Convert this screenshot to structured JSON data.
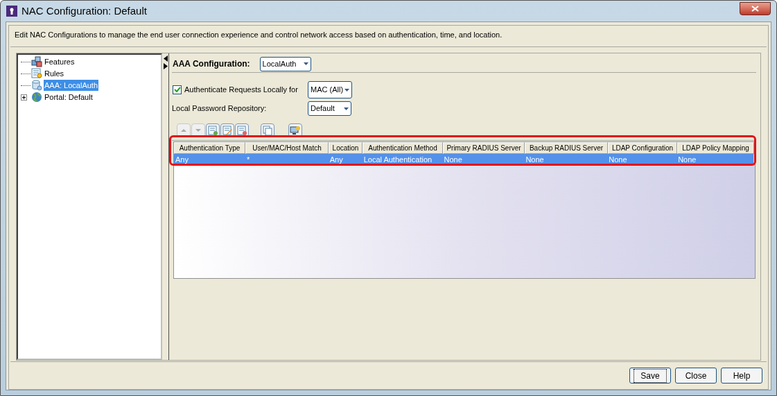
{
  "window": {
    "title": "NAC Configuration: Default"
  },
  "description": "Edit NAC Configurations to manage the end user connection experience and control network access based on authentication, time, and location.",
  "tree": [
    {
      "label": "Features",
      "kind": "features",
      "selected": false
    },
    {
      "label": "Rules",
      "kind": "rules",
      "selected": false
    },
    {
      "label": "AAA: LocalAuth",
      "kind": "database",
      "selected": true
    },
    {
      "label": "Portal: Default",
      "kind": "globe",
      "selected": false,
      "expanded": false
    }
  ],
  "aaa": {
    "label": "AAA Configuration:",
    "value": "LocalAuth"
  },
  "local_auth": {
    "label": "Authenticate Requests Locally for",
    "checked": true,
    "value": "MAC (All)"
  },
  "repository": {
    "label": "Local Password Repository:",
    "value": "Default"
  },
  "toolbar": [
    {
      "kind": "up",
      "disabled": true
    },
    {
      "kind": "down",
      "disabled": true
    },
    {
      "kind": "add",
      "disabled": false
    },
    {
      "kind": "edit",
      "disabled": false
    },
    {
      "kind": "remove",
      "disabled": false
    },
    {
      "kind": "copy",
      "disabled": false
    },
    {
      "kind": "computer",
      "disabled": false
    }
  ],
  "table": {
    "columns": [
      "Authentication Type",
      "User/MAC/Host Match",
      "Location",
      "Authentication Method",
      "Primary RADIUS Server",
      "Backup RADIUS Server",
      "LDAP Configuration",
      "LDAP Policy Mapping"
    ],
    "rows": [
      {
        "cells": [
          "Any",
          "*",
          "Any",
          "Local Authentication",
          "None",
          "None",
          "None",
          "None"
        ],
        "selected": true
      }
    ]
  },
  "buttons": [
    {
      "label": "Save",
      "focused": true
    },
    {
      "label": "Close",
      "focused": false
    },
    {
      "label": "Help",
      "focused": false
    }
  ]
}
